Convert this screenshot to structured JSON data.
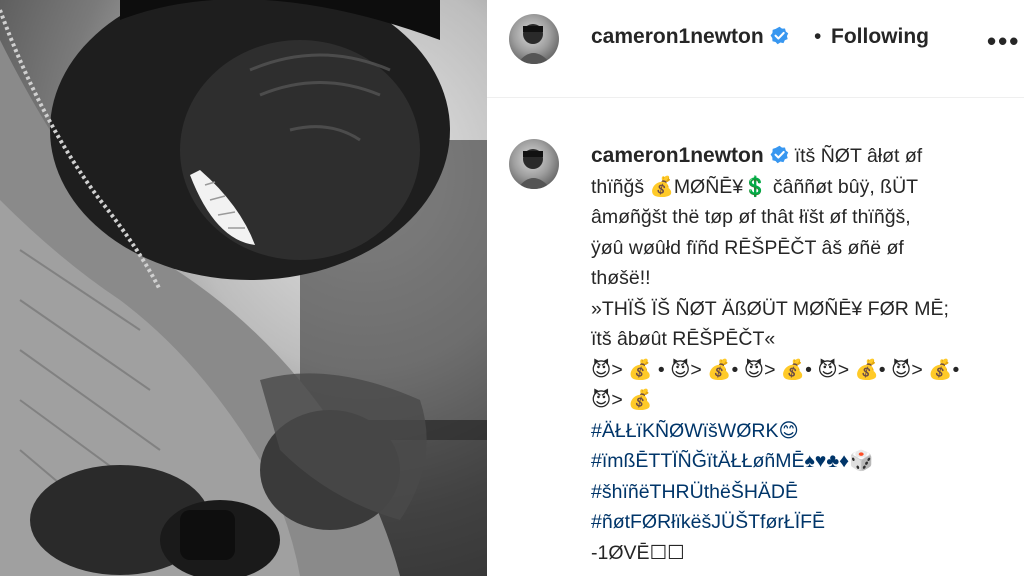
{
  "post": {
    "photo_alt": "",
    "header": {
      "username": "cameron1newton",
      "separator": "•",
      "follow_status": "Following",
      "more": "•••"
    },
    "caption": {
      "username": "cameron1newton",
      "lines": [
        "ïtš ÑØT âłøt øf",
        "thïñğš 💰MØÑĒ¥💲 čâññøt bûÿ, ßÜT",
        "âmøñğšt thë tøp øf thât łïšt øf thïñğš,",
        "ÿøû wøûłd fïñd RĒŠΡĒČT âš øñë øf",
        "thøšë!!",
        "»THÏŠ ÏŠ ÑØT ÄßØÜT MØÑĒ¥ FØR MĒ;",
        "ïtš âbøût RĒŠΡĒČT«",
        "😈> 💰 • 😈> 💰• 😈> 💰• 😈> 💰• 😈> 💰•",
        "😈> 💰"
      ],
      "hashtags": [
        "#ÄŁŁïKÑØWïšWØRK😊",
        "#ïmßĒTTÏÑĞïtÄŁŁøñMĒ♠♥♣♦🎲",
        "#šhïñëTHRÜthëŠHÄDĒ",
        "#ñøtFØRłïkëšJÜŠTførŁÏFĒ"
      ],
      "signoff": "-1ØVĒ☐☐"
    }
  }
}
